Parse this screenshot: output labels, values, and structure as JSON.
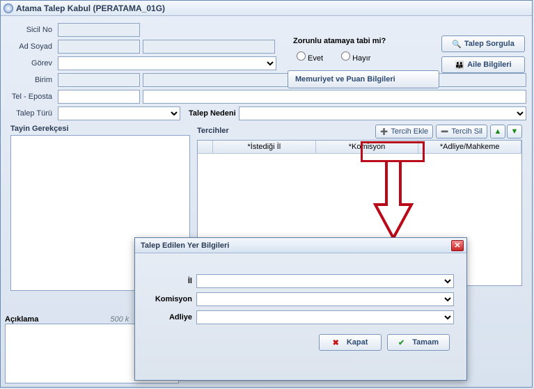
{
  "window": {
    "title": "Atama Talep Kabul (PERATAMA_01G)"
  },
  "labels": {
    "sicil_no": "Sicil No",
    "ad_soyad": "Ad Soyad",
    "gorev": "Görev",
    "birim": "Birim",
    "tel_eposta": "Tel - Eposta",
    "talep_turu": "Talep Türü",
    "talep_nedeni": "Talep Nedeni",
    "tayin_gerekcesi": "Tayin Gerekçesi",
    "tercihler": "Tercihler",
    "aciklama": "Açıklama",
    "aciklama_hint": "500 k"
  },
  "mandatory": {
    "question": "Zorunlu atamaya tabi mi?",
    "yes": "Evet",
    "no": "Hayır"
  },
  "buttons": {
    "talep_sorgula": "Talep Sorgula",
    "aile_bilgileri": "Aile Bilgileri",
    "memuriyet": "Memuriyet ve Puan Bilgileri",
    "tercih_ekle": "Tercih Ekle",
    "tercih_sil": "Tercih Sil",
    "kapat": "Kapat",
    "tamam": "Tamam"
  },
  "grid": {
    "cols": {
      "il": "*İstediği İl",
      "komisyon": "*Komisyon",
      "adliye": "*Adliye/Mahkeme"
    }
  },
  "modal": {
    "title": "Talep Edilen Yer Bilgileri",
    "il": "İl",
    "komisyon": "Komisyon",
    "adliye": "Adliye"
  },
  "arrows": {
    "up": "▲",
    "down": "▼"
  }
}
